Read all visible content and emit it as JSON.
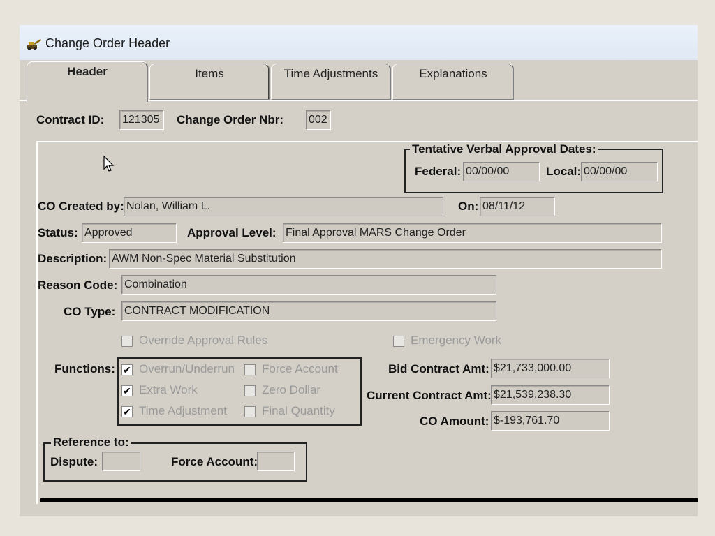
{
  "window": {
    "title": "Change Order Header"
  },
  "tabs": [
    {
      "label": "Header",
      "active": true
    },
    {
      "label": "Items",
      "active": false
    },
    {
      "label": "Time Adjustments",
      "active": false
    },
    {
      "label": "Explanations",
      "active": false
    }
  ],
  "contract": {
    "id_label": "Contract ID:",
    "id_value": "121305",
    "nbr_label": "Change Order Nbr:",
    "nbr_value": "002"
  },
  "tentative": {
    "title": "Tentative Verbal Approval Dates:",
    "federal_label": "Federal:",
    "federal_value": "00/00/00",
    "local_label": "Local:",
    "local_value": "00/00/00"
  },
  "created": {
    "label": "CO Created by:",
    "value": "Nolan, William L.",
    "on_label": "On:",
    "on_value": "08/11/12"
  },
  "status": {
    "label": "Status:",
    "value": "Approved",
    "approval_label": "Approval Level:",
    "approval_value": "Final Approval MARS Change Order"
  },
  "description": {
    "label": "Description:",
    "value": "AWM Non-Spec Material Substitution"
  },
  "reason": {
    "label": "Reason Code:",
    "value": "Combination"
  },
  "co_type": {
    "label": "CO Type:",
    "value": "CONTRACT MODIFICATION"
  },
  "options": {
    "override": {
      "label": "Override Approval Rules",
      "checked": false
    },
    "emergency": {
      "label": "Emergency Work",
      "checked": false
    }
  },
  "functions": {
    "label": "Functions:",
    "items": [
      {
        "label": "Overrun/Underrun",
        "checked": true
      },
      {
        "label": "Force Account",
        "checked": false
      },
      {
        "label": "Extra Work",
        "checked": true
      },
      {
        "label": "Zero Dollar",
        "checked": false
      },
      {
        "label": "Time Adjustment",
        "checked": true
      },
      {
        "label": "Final Quantity",
        "checked": false
      }
    ]
  },
  "amounts": {
    "bid_label": "Bid Contract Amt:",
    "bid_value": "$21,733,000.00",
    "current_label": "Current Contract Amt:",
    "current_value": "$21,539,238.30",
    "co_label": "CO Amount:",
    "co_value": "$-193,761.70"
  },
  "reference": {
    "title": "Reference to:",
    "dispute_label": "Dispute:",
    "dispute_value": "",
    "force_label": "Force Account:",
    "force_value": ""
  },
  "check_glyph": "✔",
  "icons": {
    "app": "construction-app-icon",
    "cursor": "mouse-pointer-icon"
  }
}
